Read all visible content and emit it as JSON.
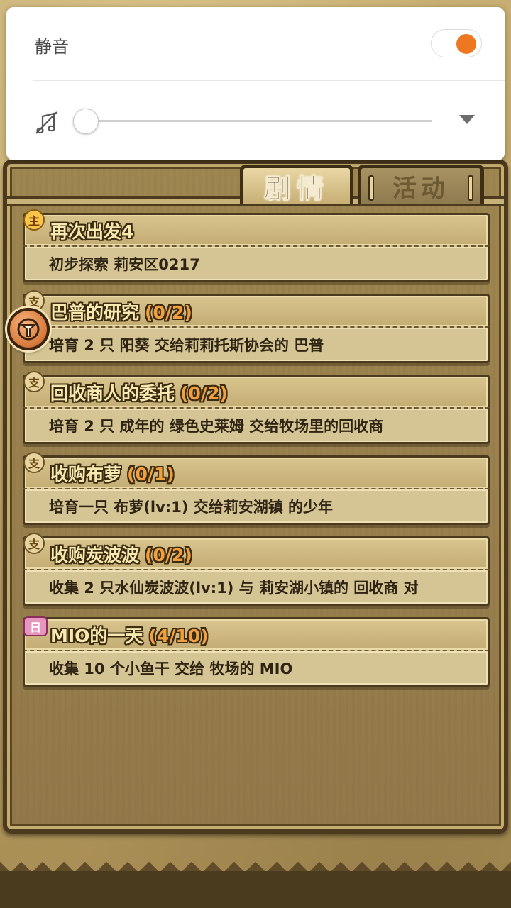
{
  "volume_popup": {
    "mute_label": "静音",
    "mute_enabled": true,
    "volume_level": 0.0,
    "accent_color": "#ee7722",
    "music_icon": "music-off-icon",
    "expand_icon": "chevron-down-icon"
  },
  "tabs": [
    {
      "label": "剧情",
      "active": true
    },
    {
      "label": "活动",
      "active": false
    }
  ],
  "quests": [
    {
      "badge": "主",
      "badge_type": "main",
      "title": "再次出发4",
      "progress": "",
      "description": "初步探索 莉安区0217"
    },
    {
      "badge": "支",
      "badge_type": "side",
      "title": "巴普的研究",
      "progress": "(0/2)",
      "description": "培育 2 只 阳葵 交给莉莉托斯协会的 巴普"
    },
    {
      "badge": "支",
      "badge_type": "side",
      "title": "回收商人的委托",
      "progress": "(0/2)",
      "description": "培育 2 只 成年的 绿色史莱姆 交给牧场里的回收商"
    },
    {
      "badge": "支",
      "badge_type": "side",
      "title": "收购布萝",
      "progress": "(0/1)",
      "description": "培育一只 布萝(lv:1) 交给莉安湖镇 的少年"
    },
    {
      "badge": "支",
      "badge_type": "side",
      "title": "收购炭波波",
      "progress": "(0/2)",
      "description": "收集 2 只水仙炭波波(lv:1) 与 莉安湖小镇的 回收商 对"
    },
    {
      "badge": "日",
      "badge_type": "daily",
      "title": "MIO的一天",
      "progress": "(4/10)",
      "description": "收集 10 个小鱼干 交给 牧场的 MIO"
    }
  ]
}
